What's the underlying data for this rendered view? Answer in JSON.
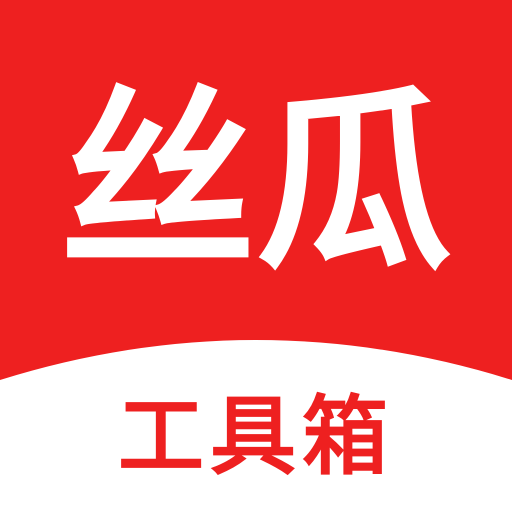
{
  "app_icon": {
    "title": "丝瓜",
    "subtitle": "工具箱",
    "colors": {
      "brand_red": "#ee2020",
      "text_white": "#ffffff",
      "background_white": "#ffffff"
    }
  }
}
